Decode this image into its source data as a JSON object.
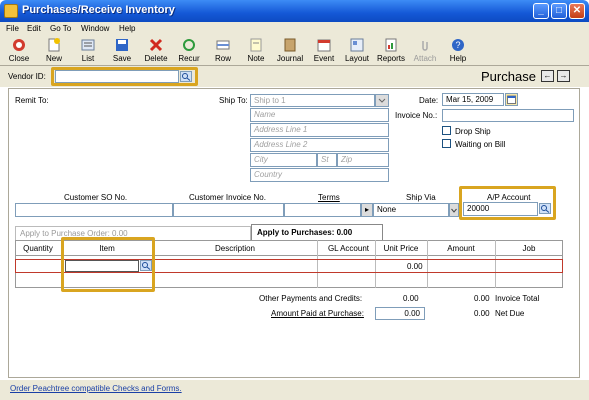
{
  "window": {
    "title": "Purchases/Receive Inventory"
  },
  "menu": [
    "File",
    "Edit",
    "Go To",
    "Window",
    "Help"
  ],
  "toolbar": [
    {
      "label": "Close",
      "icon": "close-icon"
    },
    {
      "label": "New",
      "icon": "new-icon"
    },
    {
      "label": "List",
      "icon": "list-icon"
    },
    {
      "label": "Save",
      "icon": "save-icon"
    },
    {
      "label": "Delete",
      "icon": "delete-icon"
    },
    {
      "label": "Recur",
      "icon": "recur-icon"
    },
    {
      "label": "Row",
      "icon": "row-icon"
    },
    {
      "label": "Note",
      "icon": "note-icon"
    },
    {
      "label": "Journal",
      "icon": "journal-icon"
    },
    {
      "label": "Event",
      "icon": "event-icon"
    },
    {
      "label": "Layout",
      "icon": "layout-icon"
    },
    {
      "label": "Reports",
      "icon": "reports-icon"
    },
    {
      "label": "Attach",
      "icon": "attach-icon"
    },
    {
      "label": "Help",
      "icon": "help-icon"
    }
  ],
  "vendor": {
    "label": "Vendor ID:",
    "value": ""
  },
  "form_title": "Purchase",
  "remit_to_label": "Remit To:",
  "ship_to": {
    "label": "Ship To:",
    "select_placeholder": "Ship to 1",
    "name": "Name",
    "address1": "Address Line 1",
    "address2": "Address Line 2",
    "city": "City",
    "state": "St",
    "zip": "Zip",
    "country": "Country"
  },
  "date": {
    "label": "Date:",
    "value": "Mar 15, 2009"
  },
  "invoice_no_label": "Invoice No.:",
  "drop_ship_label": "Drop Ship",
  "waiting_on_bill_label": "Waiting on Bill",
  "info_headers": {
    "customer_so": "Customer SO No.",
    "customer_invoice": "Customer Invoice No.",
    "terms": "Terms",
    "ship_via": "Ship Via",
    "ap_account": "A/P Account"
  },
  "info_values": {
    "ship_via": "None",
    "ap_account": "20000"
  },
  "tabs": {
    "apply_order": "Apply to Purchase Order: 0.00",
    "apply_purchases": "Apply to Purchases: 0.00"
  },
  "grid_headers": [
    "Quantity",
    "Item",
    "Description",
    "GL Account",
    "Unit Price",
    "Amount",
    "Job"
  ],
  "grid_row_unit_price": "0.00",
  "totals": {
    "other_label": "Other Payments and Credits:",
    "other_value": "0.00",
    "invoice_total_value": "0.00",
    "invoice_total_label": "Invoice Total",
    "paid_label": "Amount Paid at Purchase:",
    "paid_value": "0.00",
    "net_due_value": "0.00",
    "net_due_label": "Net Due"
  },
  "footer_link": "Order Peachtree compatible Checks and Forms.",
  "colors": {
    "titlebar": "#1458d6",
    "highlight": "#d9a520",
    "grid_row": "#c0392b"
  }
}
